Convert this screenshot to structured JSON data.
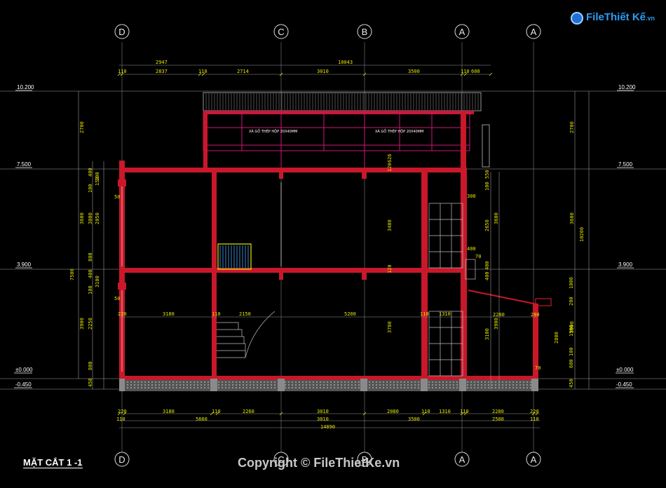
{
  "drawing_title": "MẶT CẮT 1 -1",
  "watermark": "Copyright © FileThietKe.vn",
  "logo_text": "FileThiết Kế",
  "logo_domain": ".vn",
  "axes": {
    "D": "D",
    "C": "C",
    "B": "B",
    "A1": "A",
    "A2": "A"
  },
  "levels": {
    "roof": "10.200",
    "l3": "7.500",
    "l2": "3.900",
    "l1": "±0.000",
    "base": "-0.450"
  },
  "top_dims": {
    "overall": "10043",
    "a": "2947",
    "b": "110",
    "c": "2837",
    "d": "110",
    "e": "2714",
    "f": "3010",
    "g": "3500",
    "h": "110",
    "i": "600"
  },
  "bottom_dims": {
    "r1": [
      "220",
      "3180",
      "110",
      "2260",
      "3010",
      "2080",
      "110",
      "1310",
      "110",
      "2280",
      "220"
    ],
    "r2": [
      "110",
      "5660",
      "3010",
      "3500",
      "2500",
      "110"
    ],
    "total": "14890"
  },
  "left_dims": {
    "col1": [
      "2700",
      "3600",
      "7500",
      "3900"
    ],
    "col2": [
      "400",
      "100",
      "3000",
      "800",
      "400",
      "100",
      "2250",
      "800",
      "450"
    ],
    "col3": [
      "100",
      "2050",
      "150",
      "3100"
    ],
    "note50a": "50",
    "note50b": "50"
  },
  "right_dims": {
    "col1": [
      "2700",
      "3600",
      "10200",
      "3900"
    ],
    "misc": [
      "100",
      "550",
      "300",
      "2650",
      "3600",
      "400",
      "70",
      "1000",
      "200",
      "2280",
      "280",
      "1900",
      "2800",
      "3900",
      "3100",
      "600",
      "100",
      "70",
      "400",
      "400",
      "450"
    ]
  },
  "interior_dims": {
    "i1": "220",
    "i2": "3180",
    "i3": "110",
    "i4": "2150",
    "i5": "5200",
    "i6": "110",
    "i7": "1310",
    "i8": "3480",
    "i9": "3780",
    "i10": "120",
    "i11": "120",
    "i12": "626"
  },
  "roof_notes": {
    "left": "XÀ GỒ THÉP HỘP 20X40MM",
    "right": "XÀ GỒ THÉP HỘP 20X40MM"
  },
  "colors": {
    "wall": "#c8182a",
    "dim": "#e6e600",
    "grid": "#9a9a9a",
    "truss": "#d1147a",
    "glass": "#c0c0c0",
    "stair": "#4aa8ff"
  }
}
